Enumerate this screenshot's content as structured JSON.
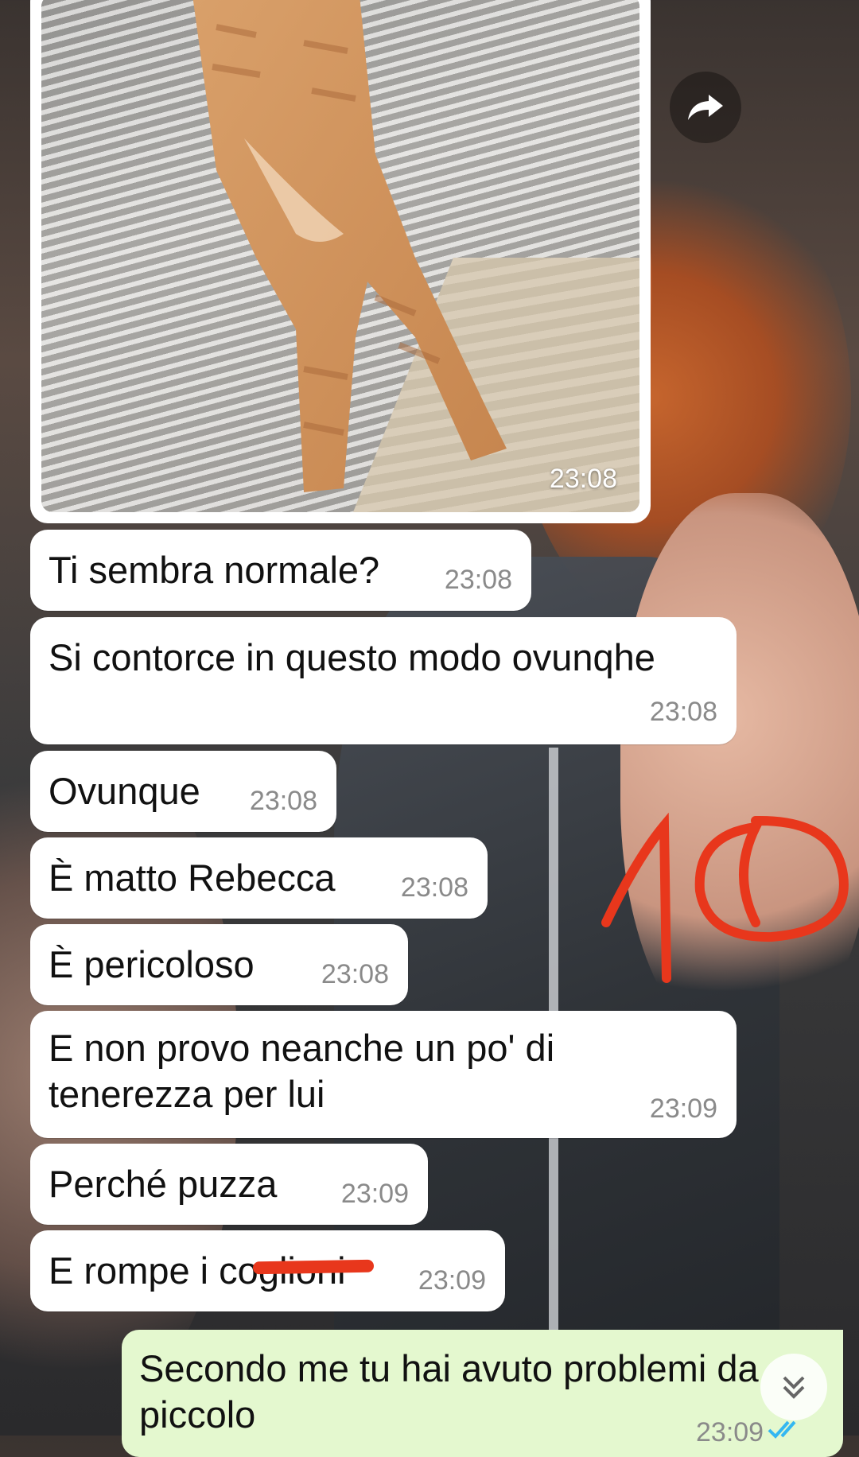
{
  "photo_message": {
    "time": "23:08"
  },
  "messages": [
    {
      "text": "Ti sembra normale?",
      "time": "23:08"
    },
    {
      "text": "Si contorce in questo modo ovunqhe",
      "time": "23:08"
    },
    {
      "text": "Ovunque",
      "time": "23:08"
    },
    {
      "text": "È matto Rebecca",
      "time": "23:08"
    },
    {
      "text": "È pericoloso",
      "time": "23:08"
    },
    {
      "text": "E non provo neanche un po' di\ntenerezza per lui",
      "time": "23:09"
    },
    {
      "text": "Perché puzza",
      "time": "23:09"
    },
    {
      "text": "E rompe i coglioni",
      "time": "23:09"
    }
  ],
  "outgoing_message": {
    "text": "Secondo me tu hai avuto problemi da piccolo",
    "time": "23:09"
  },
  "annotation": {
    "score": "10",
    "color": "#e8371c"
  },
  "colors": {
    "incoming_bubble": "#ffffff",
    "outgoing_bubble": "#e4f8cf",
    "tick_blue": "#34b7f1"
  },
  "icons": [
    "forward-icon",
    "double-check-icon",
    "chevron-double-down-icon"
  ]
}
